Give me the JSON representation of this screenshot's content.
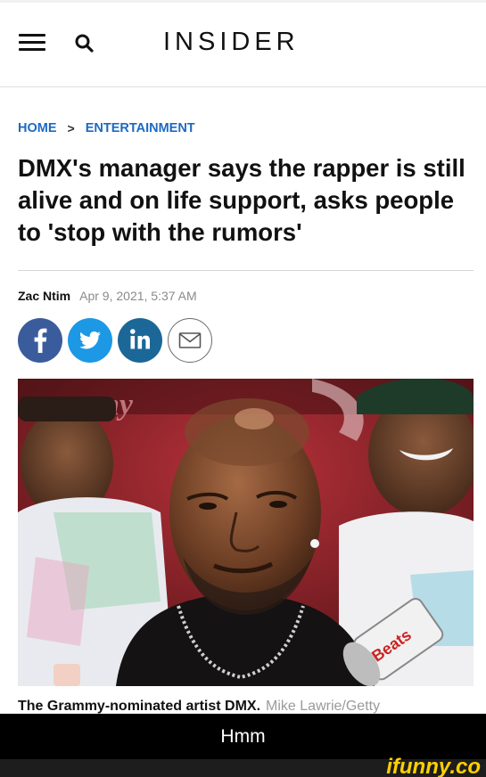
{
  "header": {
    "logo": "INSIDER",
    "menu_icon": "hamburger-menu-icon",
    "search_icon": "search-icon"
  },
  "breadcrumb": {
    "home": "HOME",
    "separator": ">",
    "section": "ENTERTAINMENT"
  },
  "article": {
    "headline": "DMX's manager says the rapper is still alive and on life support, asks people to 'stop with the rumors'",
    "author": "Zac Ntim",
    "date": "Apr 9, 2021, 5:37 AM",
    "caption": "The Grammy-nominated artist DMX.",
    "credit": "Mike Lawrie/Getty"
  },
  "share": {
    "facebook_icon": "facebook-icon",
    "twitter_icon": "twitter-icon",
    "linkedin_icon": "linkedin-icon",
    "email_icon": "email-icon"
  },
  "meme": {
    "caption": "Hmm",
    "watermark": "ifunny.co"
  },
  "colors": {
    "link_blue": "#1d69c4",
    "facebook": "#3b5c9c",
    "twitter": "#1c98e5",
    "linkedin": "#1b6798",
    "watermark_yellow": "#ffd000"
  }
}
